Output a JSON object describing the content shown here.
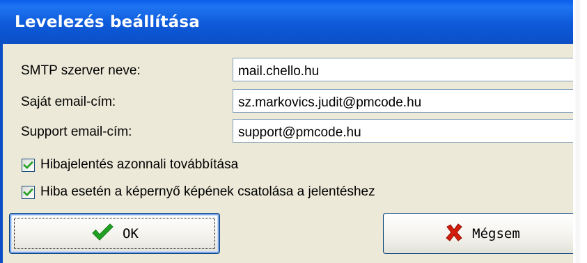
{
  "window": {
    "title": "Levelezés beállítása"
  },
  "form": {
    "smtp_label": "SMTP szerver neve:",
    "smtp_value": "mail.chello.hu",
    "own_email_label": "Saját email-cím:",
    "own_email_value": "sz.markovics.judit@pmcode.hu",
    "support_email_label": "Support email-cím:",
    "support_email_value": "support@pmcode.hu",
    "checkbox_forward_label": "Hibajelentés azonnali továbbítása",
    "checkbox_forward_checked": true,
    "checkbox_screenshot_label": "Hiba esetén a képernyő képének csatolása a jelentéshez",
    "checkbox_screenshot_checked": true
  },
  "buttons": {
    "ok_label": "OK",
    "ok_icon": "checkmark-icon",
    "cancel_label": "Mégsem",
    "cancel_icon": "red-x-icon"
  },
  "colors": {
    "titlebar": "#0b4fc6",
    "dialog_bg": "#ece9d8",
    "check_green": "#21a121",
    "cancel_red": "#d41c0c"
  }
}
